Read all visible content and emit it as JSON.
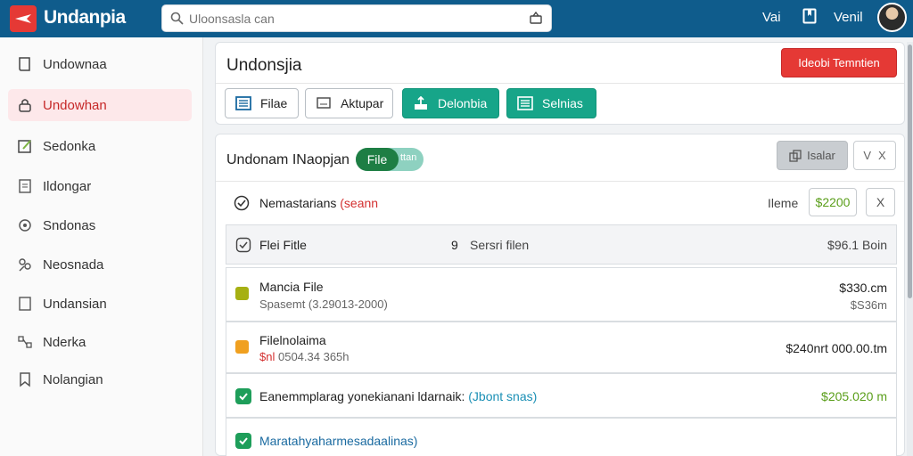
{
  "app": {
    "title": "Undanpia"
  },
  "search": {
    "placeholder": "Uloonsasla can"
  },
  "topnav": {
    "link1": "Vai",
    "link2": "Venil"
  },
  "sidebar": {
    "items": [
      {
        "label": "Undownaa",
        "icon": "book-icon"
      },
      {
        "label": "Undowhan",
        "icon": "lock-icon",
        "active": true
      },
      {
        "label": "Sedonka",
        "icon": "edit-icon"
      },
      {
        "label": "Ildongar",
        "icon": "document-icon"
      },
      {
        "label": "Sndonas",
        "icon": "settings-icon"
      },
      {
        "label": "Neosnada",
        "icon": "users-icon"
      },
      {
        "label": "Undansian",
        "icon": "square-icon"
      },
      {
        "label": "Nderka",
        "icon": "network-icon"
      },
      {
        "label": "Nolangian",
        "icon": "bookmark-icon"
      }
    ]
  },
  "header_panel": {
    "title": "Undonsjia",
    "danger_label": "Ideobi Temntien",
    "tabs": [
      {
        "label": "Filae",
        "style": "outline",
        "icon": "file-icon"
      },
      {
        "label": "Aktupar",
        "style": "outline",
        "icon": "image-icon"
      },
      {
        "label": "Delonbia",
        "style": "teal",
        "icon": "upload-icon"
      },
      {
        "label": "Selnias",
        "style": "teal",
        "icon": "list-icon"
      }
    ]
  },
  "content": {
    "title": "Undonam INaopjan",
    "pill_label": "File",
    "pill_rest": "ttan",
    "gray_button": "Isalar",
    "v_button": "V",
    "x_button": "X",
    "row1": {
      "text": "Nemastarians",
      "text_red": "(seann",
      "label": "Ileme",
      "value": "$2200",
      "close": "X"
    },
    "list_header": {
      "col1": "Flei Fitle",
      "col2_num": "9",
      "col2": "Sersri filen",
      "col3": "$96.1 Boin"
    },
    "items": [
      {
        "name": "Mancia File",
        "sub": "Spasemt (3.29013-2000)",
        "amount": "$330.cm",
        "amount2": "$S36m",
        "color": "#a6b013"
      },
      {
        "name": "Filelnolaima",
        "sub_red": "$nl",
        "sub": "0504.34 365h",
        "amount": "$240nrt 000.00.tm",
        "color": "#f0a020"
      }
    ],
    "line1": {
      "text": "Eanemmplarag yonekianani ldarnaik:",
      "highlight": "(Jbont snas)",
      "amount": "$205.020 m"
    },
    "line2": {
      "text": "Maratahyaharmesadaalinas)"
    }
  },
  "colors": {
    "topbar": "#0f5c8c",
    "accent": "#e53935",
    "teal": "#17a589",
    "green": "#1e9e5a"
  }
}
